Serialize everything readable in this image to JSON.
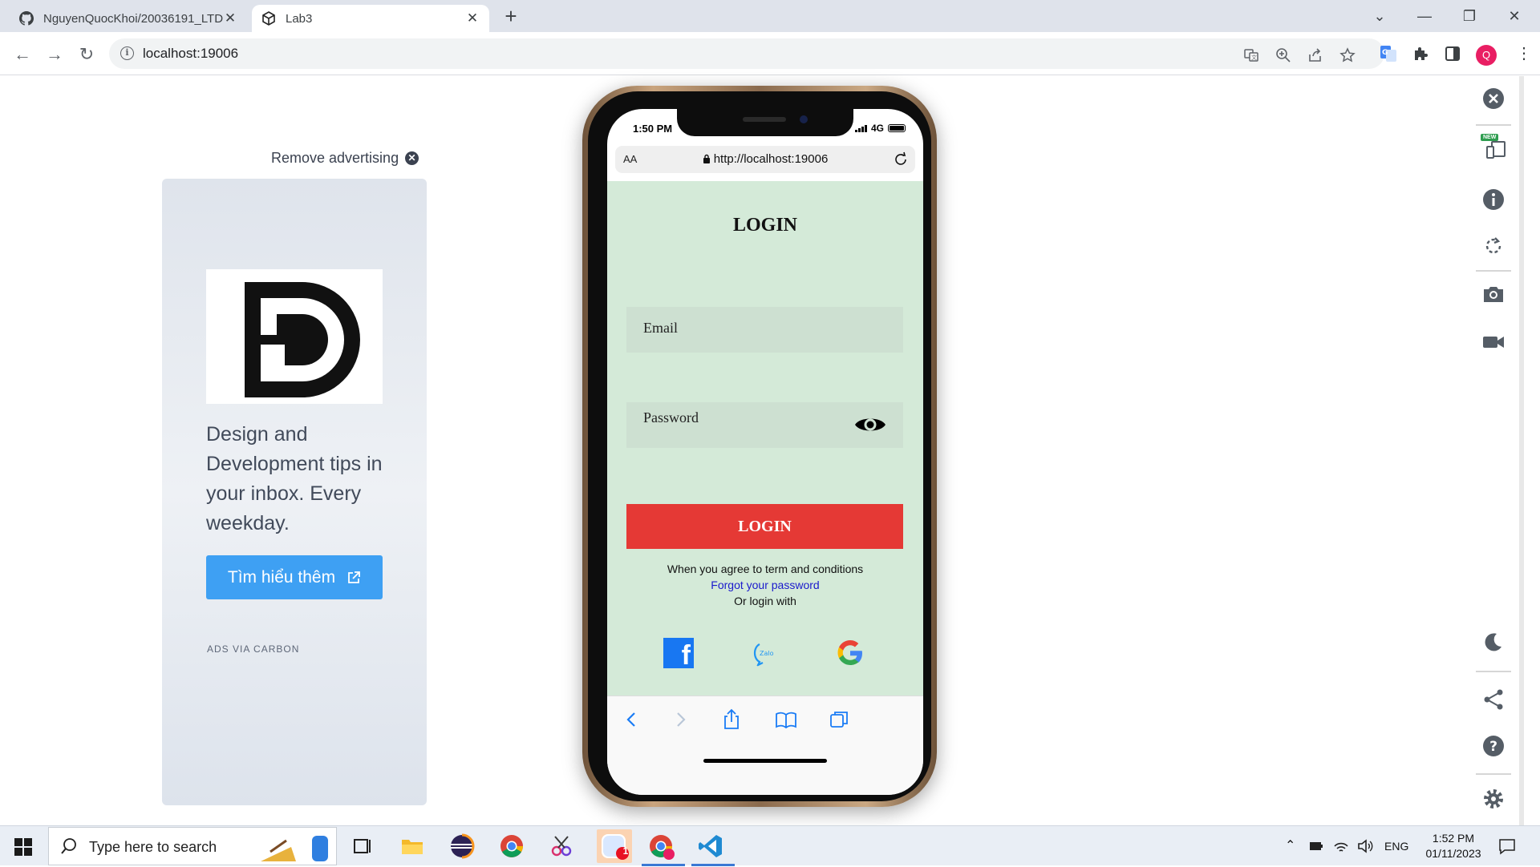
{
  "browser": {
    "tabs": [
      {
        "title": "NguyenQuocKhoi/20036191_LTD",
        "icon": "github-icon"
      },
      {
        "title": "Lab3",
        "icon": "codesandbox-icon"
      }
    ],
    "url": "localhost:19006"
  },
  "ad": {
    "remove_label": "Remove advertising",
    "text": "Design and Development tips in your inbox. Every weekday.",
    "button_label": "Tìm hiểu thêm",
    "footer": "ADS VIA CARBON"
  },
  "phone": {
    "time": "1:50 PM",
    "network": "4G",
    "safari_aa": "AA",
    "safari_url": "http://localhost:19006"
  },
  "app": {
    "title": "LOGIN",
    "email_placeholder": "Email",
    "password_placeholder": "Password",
    "login_button": "LOGIN",
    "terms": "When you agree to term and conditions",
    "forgot": "Forgot your password",
    "or_login": "Or login with",
    "social": [
      "facebook-icon",
      "zalo-icon",
      "google-icon"
    ],
    "zalo_label": "Zalo",
    "colors": {
      "background": "#d4ead8",
      "field": "#cde0d1",
      "button": "#e53935",
      "link": "#1a1acc"
    }
  },
  "side_panel": {
    "new_badge": "NEW"
  },
  "taskbar": {
    "search_placeholder": "Type here to search",
    "badge_count": "1",
    "language": "ENG",
    "time": "1:52 PM",
    "date": "01/11/2023"
  }
}
